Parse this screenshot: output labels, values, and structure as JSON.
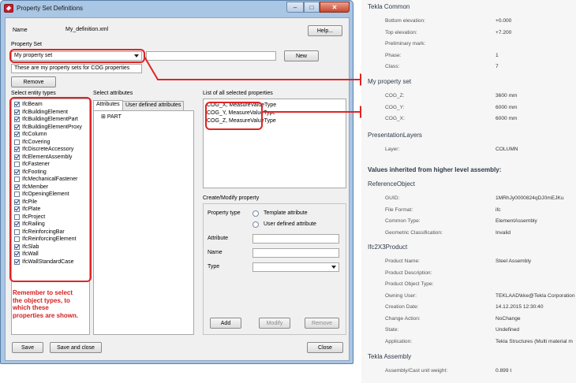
{
  "window": {
    "title": "Property Set Definitions",
    "minimize_glyph": "–",
    "maximize_glyph": "□",
    "close_glyph": "✕"
  },
  "header": {
    "name_label": "Name",
    "name_value": "My_definition.xml",
    "help_label": "Help..."
  },
  "property_set": {
    "label": "Property Set",
    "selected": "My property set",
    "new_name_value": "",
    "new_label": "New",
    "description": "These are my property sets for COG properties",
    "remove_label": "Remove"
  },
  "entities": {
    "label": "Select entity types",
    "items": [
      {
        "label": "IfcBeam",
        "checked": true
      },
      {
        "label": "IfcBuildingElement",
        "checked": true
      },
      {
        "label": "IfcBuildingElementPart",
        "checked": true
      },
      {
        "label": "IfcBuildingElementProxy",
        "checked": true
      },
      {
        "label": "IfcColumn",
        "checked": true
      },
      {
        "label": "IfcCovering",
        "checked": false
      },
      {
        "label": "IfcDiscreteAccessory",
        "checked": true
      },
      {
        "label": "IfcElementAssembly",
        "checked": true
      },
      {
        "label": "IfcFastener",
        "checked": false
      },
      {
        "label": "IfcFooting",
        "checked": true
      },
      {
        "label": "IfcMechanicalFastener",
        "checked": false
      },
      {
        "label": "IfcMember",
        "checked": true
      },
      {
        "label": "IfcOpeningElement",
        "checked": false
      },
      {
        "label": "IfcPile",
        "checked": true
      },
      {
        "label": "IfcPlate",
        "checked": true
      },
      {
        "label": "IfcProject",
        "checked": false
      },
      {
        "label": "IfcRailing",
        "checked": true
      },
      {
        "label": "IfcReinforcingBar",
        "checked": false
      },
      {
        "label": "IfcReinforcingElement",
        "checked": false
      },
      {
        "label": "IfcSlab",
        "checked": true
      },
      {
        "label": "IfcWall",
        "checked": true
      },
      {
        "label": "IfcWallStandardCase",
        "checked": true
      }
    ]
  },
  "note": [
    "Remember to select",
    "the object types, to",
    "which these",
    "properties are shown."
  ],
  "attributes": {
    "label": "Select attributes",
    "tabs": [
      "Attributes",
      "User defined attributes"
    ],
    "tree_expander": "⊞",
    "tree_root": "PART"
  },
  "selected_properties": {
    "label": "List of all selected properties",
    "items": [
      "COG_X,  MeasureValueType",
      "COG_Y,  MeasureValueType",
      "COG_Z,  MeasureValueType"
    ]
  },
  "create_modify": {
    "label": "Create/Modify property",
    "property_type_label": "Property type",
    "option_template": "Template attribute",
    "option_user": "User defined attribute",
    "attribute_label": "Attribute",
    "name_label": "Name",
    "type_label": "Type",
    "attribute_value": "",
    "name_value": "",
    "type_value": "",
    "add_label": "Add",
    "modify_label": "Modify",
    "remove_label": "Remove"
  },
  "footer": {
    "save_label": "Save",
    "save_close_label": "Save and close",
    "close_label": "Close"
  },
  "panel": {
    "tekla_common": {
      "title": "Tekla Common",
      "rows": [
        {
          "k": "Bottom elevation:",
          "v": "+0.000"
        },
        {
          "k": "Top elevation:",
          "v": "+7.200"
        },
        {
          "k": "Preliminary mark:",
          "v": ""
        },
        {
          "k": "Phase:",
          "v": "1"
        },
        {
          "k": "Class:",
          "v": "7"
        }
      ]
    },
    "my_property_set": {
      "title": "My property set",
      "rows": [
        {
          "k": "COG_Z:",
          "v": "3600 mm"
        },
        {
          "k": "COG_Y:",
          "v": "6000 mm"
        },
        {
          "k": "COG_X:",
          "v": "6000 mm"
        }
      ]
    },
    "presentation_layers": {
      "title": "PresentationLayers",
      "rows": [
        {
          "k": "Layer:",
          "v": "COLUMN"
        }
      ]
    },
    "inherited_title": "Values inherited from higher level assembly:",
    "reference_object": {
      "title": "ReferenceObject",
      "rows": [
        {
          "k": "GUID:",
          "v": "1MRhJy0000824qDJ0mEJKu"
        },
        {
          "k": "File Format:",
          "v": "ifc"
        },
        {
          "k": "Common Type:",
          "v": "ElementAssembly"
        },
        {
          "k": "Geometric Classification:",
          "v": "Invalid"
        }
      ]
    },
    "ifc2x3product": {
      "title": "Ifc2X3Product",
      "rows": [
        {
          "k": "Product Name:",
          "v": "Steel Assembly"
        },
        {
          "k": "Product Description:",
          "v": ""
        },
        {
          "k": "Product Object Type:",
          "v": ""
        },
        {
          "k": "Owning User:",
          "v": "TEKLAAD\\kke@Tekla Corporation"
        },
        {
          "k": "Creation Date:",
          "v": "14.12.2015 12:30:40"
        },
        {
          "k": "Change Action:",
          "v": "NoChange"
        },
        {
          "k": "State:",
          "v": "Undefined"
        },
        {
          "k": "Application:",
          "v": "Tekla Structures (Multi material m"
        }
      ]
    },
    "tekla_assembly": {
      "title": "Tekla Assembly",
      "rows": [
        {
          "k": "Assembly/Cast unit weight:",
          "v": "0.899 t"
        }
      ]
    }
  },
  "colors": {
    "highlight": "#e02424",
    "window_frame": "#a9c6e4",
    "client_bg": "#f0f0f0"
  }
}
